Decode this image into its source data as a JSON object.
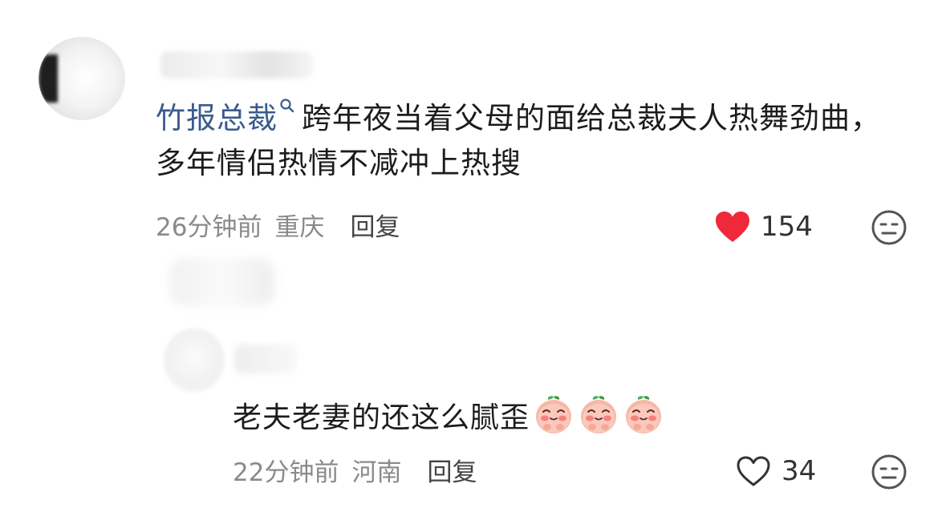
{
  "comment": {
    "mention": "竹报总裁",
    "text": "跨年夜当着父母的面给总裁夫人热舞劲曲，多年情侣热情不减冲上热搜",
    "time": "26分钟前",
    "location": "重庆",
    "reply_label": "回复",
    "like_count": "154",
    "liked": true
  },
  "reply": {
    "text": "老夫老妻的还这么腻歪",
    "emoji": [
      "peach-shy-emoji",
      "peach-shy-emoji",
      "peach-shy-emoji"
    ],
    "time": "22分钟前",
    "location": "河南",
    "reply_label": "回复",
    "like_count": "34",
    "liked": false
  },
  "colors": {
    "mention": "#3a5b8c",
    "heart_liked": "#f0283c",
    "meta_text": "#8a8a8a"
  },
  "icons": {
    "mention_suffix": "search-icon",
    "like_active": "heart-filled-icon",
    "like_inactive": "heart-outline-icon",
    "more": "neutral-face-icon"
  }
}
